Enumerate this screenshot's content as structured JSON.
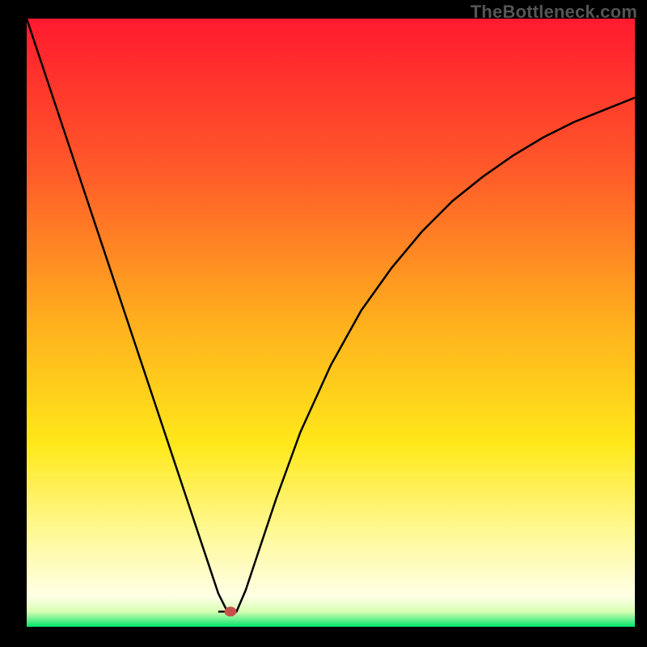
{
  "watermark": "TheBottleneck.com",
  "chart_data": {
    "type": "line",
    "title": "",
    "xlabel": "",
    "ylabel": "",
    "xlim": [
      0,
      100
    ],
    "ylim": [
      0,
      100
    ],
    "gradient_stops": [
      {
        "offset": 0,
        "color": "#ff1a2f"
      },
      {
        "offset": 0.25,
        "color": "#ff5a29"
      },
      {
        "offset": 0.5,
        "color": "#ffb01e"
      },
      {
        "offset": 0.7,
        "color": "#ffe81a"
      },
      {
        "offset": 0.85,
        "color": "#fff99a"
      },
      {
        "offset": 0.95,
        "color": "#ffffe6"
      },
      {
        "offset": 0.975,
        "color": "#d9ffb3"
      },
      {
        "offset": 1.0,
        "color": "#00e56b"
      }
    ],
    "marker": {
      "x": 33.5,
      "y": 2.5,
      "color": "#c8504b",
      "r": 1.0
    },
    "series": [
      {
        "name": "curve",
        "x": [
          0,
          4,
          8,
          12,
          16,
          20,
          24,
          28,
          30,
          31.5,
          33,
          34.5,
          36,
          38,
          41,
          45,
          50,
          55,
          60,
          65,
          70,
          75,
          80,
          85,
          90,
          95,
          100
        ],
        "y": [
          100,
          88,
          76,
          64,
          52,
          40,
          28,
          16,
          10,
          5.5,
          2.5,
          2.5,
          6,
          12,
          21,
          32,
          43,
          52,
          59,
          65,
          70,
          74,
          77.5,
          80.5,
          83,
          85,
          87
        ]
      },
      {
        "name": "flat-bottom",
        "x": [
          31.5,
          34.5
        ],
        "y": [
          2.5,
          2.5
        ]
      }
    ]
  }
}
